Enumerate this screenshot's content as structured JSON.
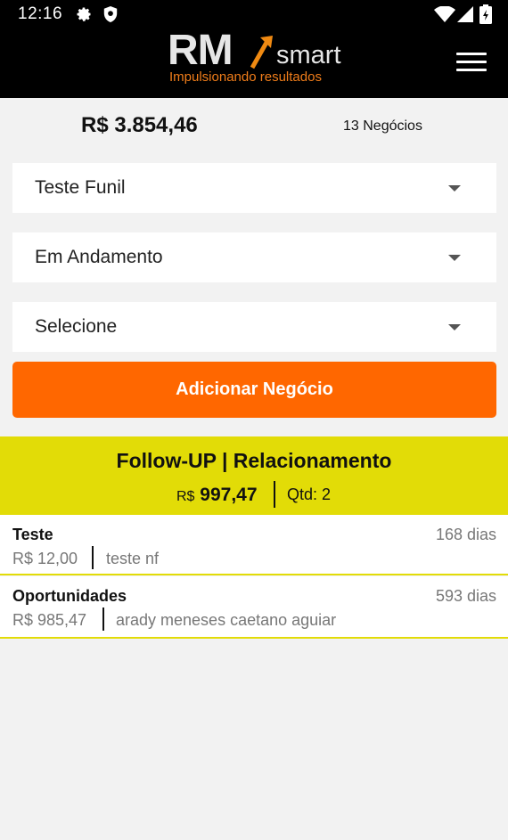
{
  "status_bar": {
    "time": "12:16",
    "icons": [
      "gear-icon",
      "shield-icon",
      "wifi-icon",
      "signal-icon",
      "battery-icon"
    ]
  },
  "app_bar": {
    "logo_text": "RM",
    "logo_suffix": "smart",
    "tagline": "Impulsionando resultados",
    "menu_icon": "hamburger-menu-icon"
  },
  "summary": {
    "total_value": "R$ 3.854,46",
    "deal_count": "13 Negócios"
  },
  "filters": {
    "funnel": "Teste Funil",
    "status": "Em Andamento",
    "third": "Selecione"
  },
  "actions": {
    "add_deal_label": "Adicionar Negócio"
  },
  "stage": {
    "title": "Follow-UP | Relacionamento",
    "currency": "R$",
    "sum": "997,47",
    "qty": "Qtd: 2"
  },
  "deals": [
    {
      "title": "Teste",
      "days": "168 dias",
      "value": "R$ 12,00",
      "contact": "teste nf"
    },
    {
      "title": "Oportunidades",
      "days": "593 dias",
      "value": "R$ 985,47",
      "contact": "arady meneses caetano aguiar"
    }
  ],
  "colors": {
    "accent_orange": "#ff6700",
    "stage_yellow": "#e2dc07",
    "tagline_orange": "#f07d1a"
  }
}
